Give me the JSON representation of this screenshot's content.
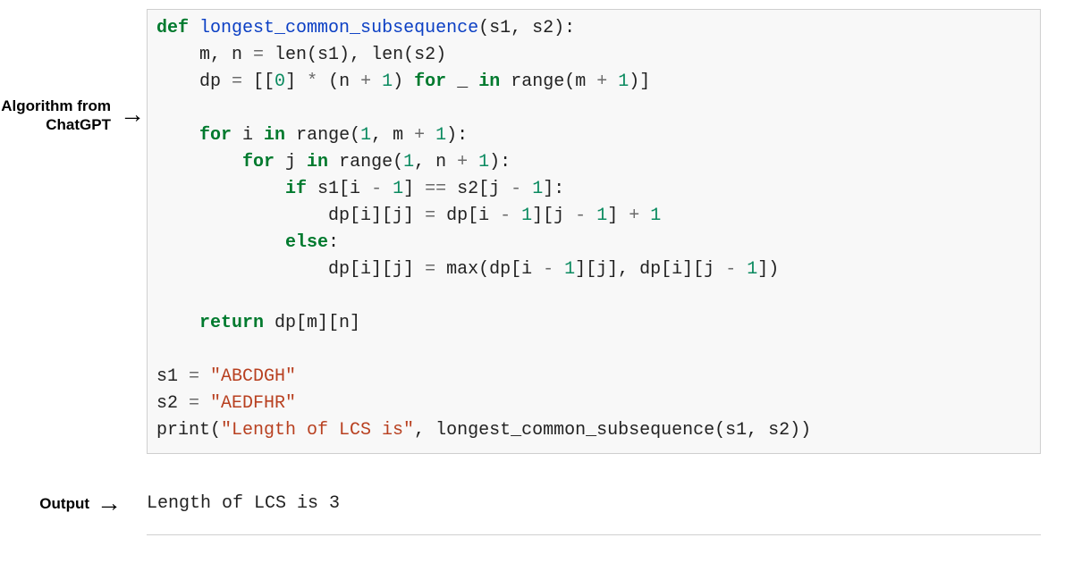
{
  "labels": {
    "algorithm": "Algorithm\nfrom ChatGPT",
    "output": "Output"
  },
  "code": {
    "l1": {
      "def": "def",
      "name": "longest_common_subsequence",
      "args": "(s1, s2):"
    },
    "l2": {
      "pre": "    m, n ",
      "eq": "=",
      "rest1": " len(s1), len(s2)"
    },
    "l3": {
      "pre": "    dp ",
      "eq": "=",
      "b1": " [[",
      "zero": "0",
      "b2": "] ",
      "star": "*",
      "b3": " (n ",
      "plus1": "+",
      "sp1": " ",
      "one1": "1",
      "b4": ") ",
      "forw": "for",
      "b5": " _ ",
      "inw": "in",
      "b6": " range(m ",
      "plus2": "+",
      "sp2": " ",
      "one2": "1",
      "b7": ")]"
    },
    "l5": {
      "ind": "    ",
      "forw": "for",
      "a": " i ",
      "inw": "in",
      "b": " range(",
      "one": "1",
      "c": ", m ",
      "plus": "+",
      "sp": " ",
      "one2": "1",
      "d": "):"
    },
    "l6": {
      "ind": "        ",
      "forw": "for",
      "a": " j ",
      "inw": "in",
      "b": " range(",
      "one": "1",
      "c": ", n ",
      "plus": "+",
      "sp": " ",
      "one2": "1",
      "d": "):"
    },
    "l7": {
      "ind": "            ",
      "ifw": "if",
      "a": " s1[i ",
      "m1": "-",
      "sp1": " ",
      "n1": "1",
      "b": "] ",
      "eq": "==",
      "c": " s2[j ",
      "m2": "-",
      "sp2": " ",
      "n2": "1",
      "d": "]:"
    },
    "l8": {
      "ind": "                dp[i][j] ",
      "eq": "=",
      "a": " dp[i ",
      "m1": "-",
      "sp1": " ",
      "n1": "1",
      "b": "][j ",
      "m2": "-",
      "sp2": " ",
      "n2": "1",
      "c": "] ",
      "plus": "+",
      "sp3": " ",
      "n3": "1"
    },
    "l9": {
      "ind": "            ",
      "elsew": "else",
      "colon": ":"
    },
    "l10": {
      "ind": "                dp[i][j] ",
      "eq": "=",
      "a": " max(dp[i ",
      "m1": "-",
      "sp1": " ",
      "n1": "1",
      "b": "][j], dp[i][j ",
      "m2": "-",
      "sp2": " ",
      "n2": "1",
      "c": "])"
    },
    "l12": {
      "ind": "    ",
      "ret": "return",
      "a": " dp[m][n]"
    },
    "l14": {
      "a": "s1 ",
      "eq": "=",
      "sp": " ",
      "str": "\"ABCDGH\""
    },
    "l15": {
      "a": "s2 ",
      "eq": "=",
      "sp": " ",
      "str": "\"AEDFHR\""
    },
    "l16": {
      "a": "print(",
      "str": "\"Length of LCS is\"",
      "b": ", longest_common_subsequence(s1, s2))"
    }
  },
  "output_text": "Length of LCS is 3"
}
